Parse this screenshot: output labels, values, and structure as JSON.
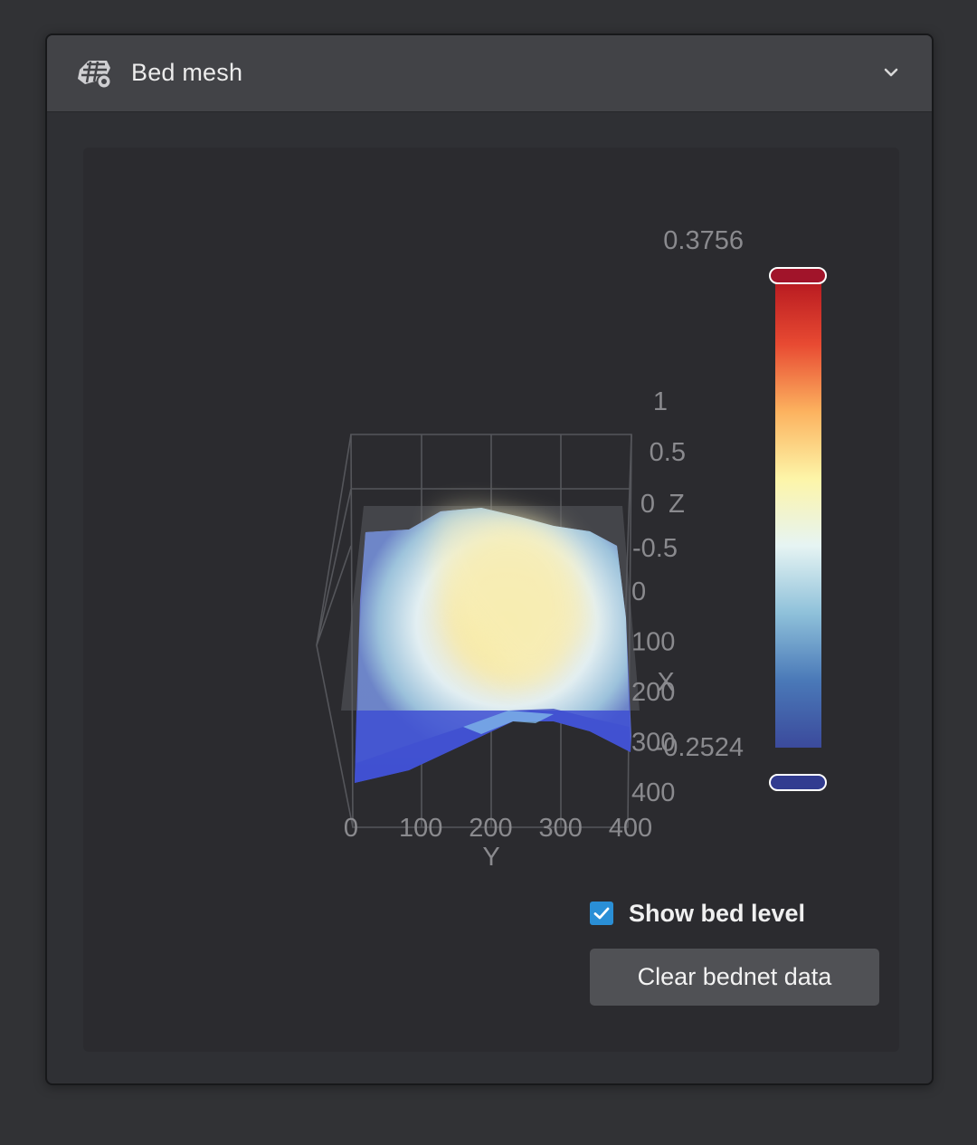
{
  "panel": {
    "title": "Bed mesh",
    "header_icon": "bed-mesh-gear-icon",
    "collapse_icon": "chevron-down-icon"
  },
  "chart_data": {
    "type": "surface3d",
    "x_axis": {
      "label": "X",
      "ticks": [
        "0",
        "100",
        "200",
        "300",
        "400"
      ]
    },
    "y_axis": {
      "label": "Y",
      "ticks": [
        "0",
        "100",
        "200",
        "300",
        "400"
      ]
    },
    "z_axis": {
      "label": "Z",
      "ticks": [
        "1",
        "0.5",
        "0",
        "-0.5"
      ]
    },
    "colorbar": {
      "max_label": "0.3756",
      "min_label": "-0.2524",
      "max": 0.3756,
      "min": -0.2524,
      "colors": [
        "#3b4a9c",
        "#4a79b8",
        "#8fc1da",
        "#e6f4f3",
        "#fdf5a8",
        "#fcb25f",
        "#e84a32",
        "#b4161f"
      ]
    }
  },
  "controls": {
    "show_bed_level_label": "Show bed level",
    "show_bed_level_checked": true,
    "clear_button_label": "Clear bednet data"
  }
}
